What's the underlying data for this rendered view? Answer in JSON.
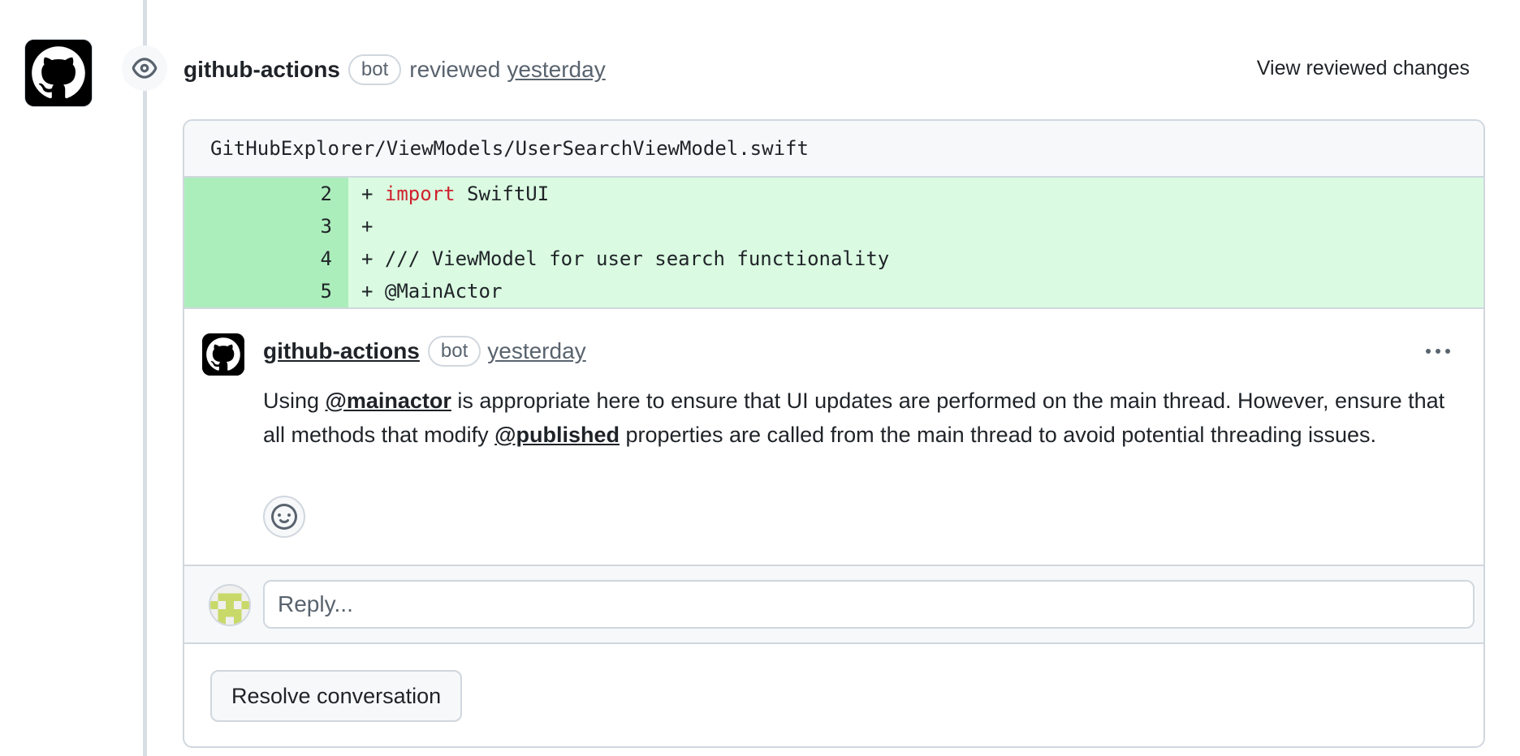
{
  "review": {
    "author": "github-actions",
    "badge": "bot",
    "action": "reviewed",
    "time": "yesterday",
    "view_changes": "View reviewed changes"
  },
  "file": {
    "path": "GitHubExplorer/ViewModels/UserSearchViewModel.swift"
  },
  "diff": {
    "lines": [
      {
        "num": "2",
        "prefix": "+ ",
        "keyword": "import",
        "rest": " SwiftUI"
      },
      {
        "num": "3",
        "prefix": "+",
        "keyword": "",
        "rest": ""
      },
      {
        "num": "4",
        "prefix": "+ ",
        "keyword": "",
        "rest": "/// ViewModel for user search functionality"
      },
      {
        "num": "5",
        "prefix": "+ ",
        "keyword": "",
        "rest": "@MainActor"
      }
    ]
  },
  "comment": {
    "author": "github-actions",
    "badge": "bot",
    "time": "yesterday",
    "body": {
      "part1": "Using ",
      "mention1": "@mainactor",
      "part2": " is appropriate here to ensure that UI updates are performed on the main thread. However, ensure that all methods that modify ",
      "mention2": "@published",
      "part3": " properties are called from the main thread to avoid potential threading issues."
    }
  },
  "reply": {
    "placeholder": "Reply..."
  },
  "resolve": {
    "label": "Resolve conversation"
  },
  "colors": {
    "added_line_bg": "#dafbe1",
    "added_num_bg": "#aceebb",
    "keyword": "#cf222e",
    "muted_text": "#59636e",
    "border": "#d0d7de"
  },
  "icons": {
    "review_type": "eye-icon",
    "avatar": "github-octocat-icon",
    "reaction": "smiley-icon",
    "menu": "kebab-horizontal-icon"
  }
}
